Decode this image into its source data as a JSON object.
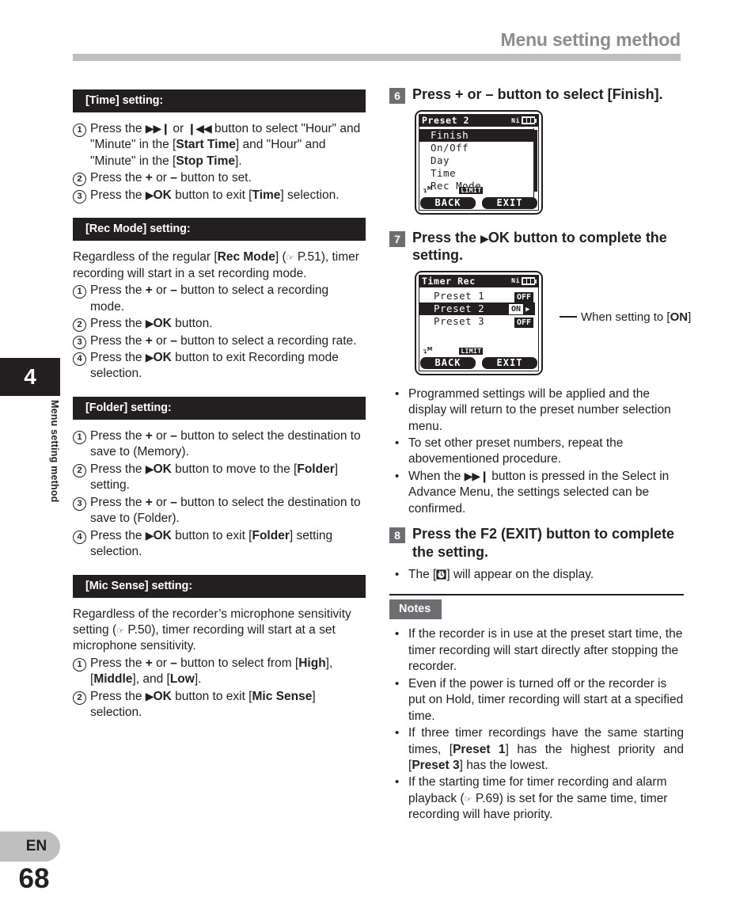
{
  "header": {
    "title": "Menu setting method"
  },
  "sidebar": {
    "chapter_number": "4",
    "chapter_label": "Menu setting method",
    "language": "EN",
    "page_number": "68"
  },
  "left_column": {
    "sections": [
      {
        "heading": "[Time] setting:",
        "intro": null,
        "steps": [
          {
            "num": "①",
            "parts": [
              {
                "t": "Press the "
              },
              {
                "t": "▶▶❙",
                "glyph": true
              },
              {
                "t": " or "
              },
              {
                "t": "❙◀◀",
                "glyph": true
              },
              {
                "t": " button to select \"Hour\" and \"Minute\" in the ["
              },
              {
                "t": "Start Time",
                "b": true
              },
              {
                "t": "] and \"Hour\" and \"Minute\" in the ["
              },
              {
                "t": "Stop Time",
                "b": true
              },
              {
                "t": "]."
              }
            ]
          },
          {
            "num": "②",
            "parts": [
              {
                "t": "Press the "
              },
              {
                "t": "+",
                "b": true
              },
              {
                "t": " or "
              },
              {
                "t": "–",
                "b": true
              },
              {
                "t": " button to set."
              }
            ]
          },
          {
            "num": "③",
            "parts": [
              {
                "t": "Press the "
              },
              {
                "t": "▶",
                "glyph": true
              },
              {
                "t": "OK",
                "b": true
              },
              {
                "t": " button to exit ["
              },
              {
                "t": "Time",
                "b": true
              },
              {
                "t": "] selection."
              }
            ]
          }
        ]
      },
      {
        "heading": "[Rec Mode] setting:",
        "intro": [
          {
            "t": "Regardless of the regular ["
          },
          {
            "t": "Rec Mode",
            "b": true
          },
          {
            "t": "] ("
          },
          {
            "t": "☞",
            "hand": true
          },
          {
            "t": " P.51), timer recording will start in a set recording mode."
          }
        ],
        "steps": [
          {
            "num": "①",
            "parts": [
              {
                "t": "Press the "
              },
              {
                "t": "+",
                "b": true
              },
              {
                "t": " or "
              },
              {
                "t": "–",
                "b": true
              },
              {
                "t": " button to select a recording mode."
              }
            ]
          },
          {
            "num": "②",
            "parts": [
              {
                "t": "Press the "
              },
              {
                "t": "▶",
                "glyph": true
              },
              {
                "t": "OK",
                "b": true
              },
              {
                "t": " button."
              }
            ]
          },
          {
            "num": "③",
            "parts": [
              {
                "t": "Press the "
              },
              {
                "t": "+",
                "b": true
              },
              {
                "t": " or "
              },
              {
                "t": "–",
                "b": true
              },
              {
                "t": " button to select a recording rate."
              }
            ]
          },
          {
            "num": "④",
            "parts": [
              {
                "t": "Press the "
              },
              {
                "t": "▶",
                "glyph": true
              },
              {
                "t": "OK",
                "b": true
              },
              {
                "t": " button to exit Recording mode selection."
              }
            ]
          }
        ]
      },
      {
        "heading": "[Folder] setting:",
        "intro": null,
        "steps": [
          {
            "num": "①",
            "parts": [
              {
                "t": "Press the "
              },
              {
                "t": "+",
                "b": true
              },
              {
                "t": " or "
              },
              {
                "t": "–",
                "b": true
              },
              {
                "t": " button to select the destination to save to (Memory)."
              }
            ]
          },
          {
            "num": "②",
            "parts": [
              {
                "t": "Press the "
              },
              {
                "t": "▶",
                "glyph": true
              },
              {
                "t": "OK",
                "b": true
              },
              {
                "t": " button to move to the ["
              },
              {
                "t": "Folder",
                "b": true
              },
              {
                "t": "] setting."
              }
            ]
          },
          {
            "num": "③",
            "parts": [
              {
                "t": "Press the "
              },
              {
                "t": "+",
                "b": true
              },
              {
                "t": " or "
              },
              {
                "t": "–",
                "b": true
              },
              {
                "t": " button to select the destination to save to (Folder)."
              }
            ]
          },
          {
            "num": "④",
            "parts": [
              {
                "t": "Press the "
              },
              {
                "t": "▶",
                "glyph": true
              },
              {
                "t": "OK",
                "b": true
              },
              {
                "t": " button to exit ["
              },
              {
                "t": "Folder",
                "b": true
              },
              {
                "t": "] setting selection."
              }
            ]
          }
        ]
      },
      {
        "heading": "[Mic Sense] setting:",
        "intro": [
          {
            "t": "Regardless of the recorder’s microphone sensitivity setting ("
          },
          {
            "t": "☞",
            "hand": true
          },
          {
            "t": " P.50), timer recording will start at a set microphone sensitivity."
          }
        ],
        "steps": [
          {
            "num": "①",
            "parts": [
              {
                "t": "Press the "
              },
              {
                "t": "+",
                "b": true
              },
              {
                "t": " or "
              },
              {
                "t": "–",
                "b": true
              },
              {
                "t": " button to select from ["
              },
              {
                "t": "High",
                "b": true
              },
              {
                "t": "], ["
              },
              {
                "t": "Middle",
                "b": true
              },
              {
                "t": "], and ["
              },
              {
                "t": "Low",
                "b": true
              },
              {
                "t": "]."
              }
            ]
          },
          {
            "num": "②",
            "parts": [
              {
                "t": "Press the "
              },
              {
                "t": "▶",
                "glyph": true
              },
              {
                "t": "OK",
                "b": true
              },
              {
                "t": " button to exit ["
              },
              {
                "t": "Mic Sense",
                "b": true
              },
              {
                "t": "] selection."
              }
            ]
          }
        ]
      }
    ]
  },
  "right_column": {
    "step6": {
      "number": "6",
      "text_parts": [
        {
          "t": "Press + or – button to select ["
        },
        {
          "t": "Finish",
          "b": true
        },
        {
          "t": "]."
        }
      ]
    },
    "lcd1": {
      "title": "Preset 2",
      "battery_label": "Ni",
      "rows": [
        {
          "label": "Finish",
          "selected": true
        },
        {
          "label": "On/Off",
          "selected": false
        },
        {
          "label": "Day",
          "selected": false
        },
        {
          "label": "Time",
          "selected": false
        },
        {
          "label": "Rec Mode",
          "selected": false
        }
      ],
      "status_mic": "M",
      "status_limit": "LIMIT",
      "fkey_left": "BACK",
      "fkey_right": "EXIT"
    },
    "step7": {
      "number": "7",
      "text_parts": [
        {
          "t": "Press the "
        },
        {
          "t": "▶",
          "glyph": true
        },
        {
          "t": "OK",
          "b": true
        },
        {
          "t": " button to complete the setting."
        }
      ]
    },
    "lcd2": {
      "title": "Timer Rec",
      "battery_label": "Ni",
      "rows": [
        {
          "label": "Preset 1",
          "value": "OFF",
          "selected": false,
          "arrow": false
        },
        {
          "label": "Preset 2",
          "value": "ON",
          "selected": true,
          "arrow": true
        },
        {
          "label": "Preset 3",
          "value": "OFF",
          "selected": false,
          "arrow": false
        }
      ],
      "status_mic": "M",
      "status_limit": "LIMIT",
      "fkey_left": "BACK",
      "fkey_right": "EXIT"
    },
    "callout": {
      "parts": [
        {
          "t": "When setting to ["
        },
        {
          "t": "ON",
          "b": true
        },
        {
          "t": "]"
        }
      ]
    },
    "step7_bullets": [
      [
        {
          "t": "Programmed settings will be applied and the display will return to the preset number selection menu."
        }
      ],
      [
        {
          "t": "To set other preset numbers, repeat the abovementioned procedure."
        }
      ],
      [
        {
          "t": "When the "
        },
        {
          "t": "▶▶❙",
          "glyph": true
        },
        {
          "t": " button is pressed in the Select in Advance Menu, the settings selected can be confirmed."
        }
      ]
    ],
    "step8": {
      "number": "8",
      "text_parts": [
        {
          "t": "Press the F2 (EXIT) button to complete the setting."
        }
      ]
    },
    "step8_bullets": [
      [
        {
          "t": "The ["
        },
        {
          "t": "TIMER_ICON",
          "icon": true
        },
        {
          "t": "] will appear on the display."
        }
      ]
    ],
    "notes": {
      "badge": "Notes",
      "items": [
        [
          {
            "t": "If the recorder is in use at the preset start time, the timer recording will start directly after stopping the recorder."
          }
        ],
        [
          {
            "t": "Even if the power is turned off or the recorder is put on Hold, timer recording will start at a specified time."
          }
        ],
        [
          {
            "t": "If three timer recordings have the same starting times, ["
          },
          {
            "t": "Preset 1",
            "b": true
          },
          {
            "t": "] has the highest priority and ["
          },
          {
            "t": "Preset 3",
            "b": true
          },
          {
            "t": "] has the lowest."
          }
        ],
        [
          {
            "t": "If the starting time for timer recording and alarm playback ("
          },
          {
            "t": "☞",
            "hand": true
          },
          {
            "t": " P.69) is set for the same time, timer recording will have priority."
          }
        ]
      ],
      "justified_indices": [
        2
      ]
    }
  },
  "colors": {
    "ink": "#231f20",
    "header_gray": "#8d8d8d",
    "rule_gray": "#bfbfbf",
    "badge_gray": "#6d6e71"
  }
}
